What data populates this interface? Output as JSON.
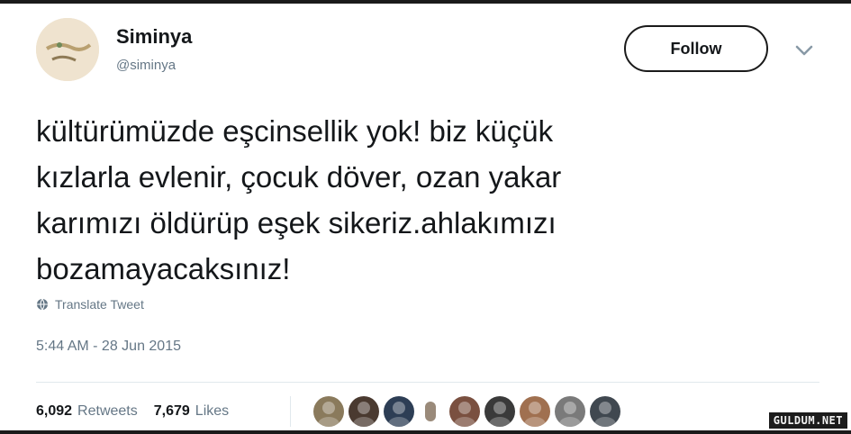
{
  "author": {
    "display_name": "Siminya",
    "handle": "@siminya",
    "avatar_icon": "profile-photo"
  },
  "header": {
    "follow_label": "Follow",
    "caret_icon": "chevron-down-icon"
  },
  "tweet": {
    "text": "kültürümüzde eşcinsellik yok! biz küçük\nkızlarla evlenir, çocuk döver, ozan yakar\nkarımızı öldürüp eşek sikeriz.ahlakımızı\nbozamayacaksınız!",
    "translate_label": "Translate Tweet",
    "translate_icon": "globe-icon",
    "timestamp": "5:44 AM - 28 Jun 2015"
  },
  "stats": {
    "retweets_count": "6,092",
    "retweets_label": "Retweets",
    "likes_count": "7,679",
    "likes_label": "Likes"
  },
  "likers": [
    {
      "name": "liker-avatar",
      "color": "#8a7a5c"
    },
    {
      "name": "liker-avatar",
      "color": "#4a3a30"
    },
    {
      "name": "liker-avatar",
      "color": "#2d3e55"
    },
    {
      "name": "liker-avatar",
      "color": "#9a8a7a"
    },
    {
      "name": "liker-avatar",
      "color": "#7a5040"
    },
    {
      "name": "liker-avatar",
      "color": "#3a3a3a"
    },
    {
      "name": "liker-avatar",
      "color": "#a07050"
    },
    {
      "name": "liker-avatar",
      "color": "#7a7a7a"
    },
    {
      "name": "liker-avatar",
      "color": "#404850"
    }
  ],
  "watermark": "GULDUM.NET",
  "colors": {
    "text_primary": "#14171a",
    "text_secondary": "#657786",
    "divider": "#e1e8ed",
    "frame": "#1a1a1a"
  }
}
